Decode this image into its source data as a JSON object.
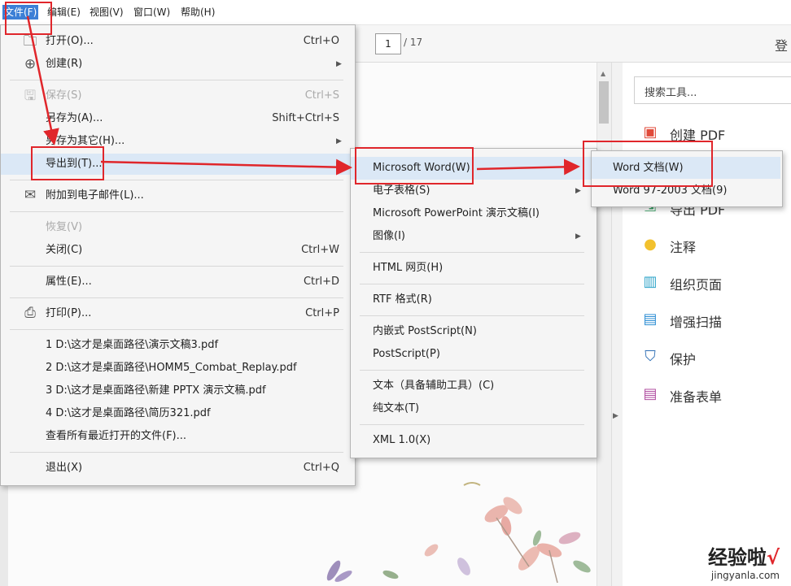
{
  "menubar": [
    "文件(F)",
    "编辑(E)",
    "视图(V)",
    "窗口(W)",
    "帮助(H)"
  ],
  "page": {
    "current": "1",
    "total": "/ 17"
  },
  "login": "登",
  "search_placeholder": "搜索工具...",
  "tools": [
    "创建 PDF",
    "导出 PDF",
    "注释",
    "组织页面",
    "增强扫描",
    "保护",
    "准备表单"
  ],
  "file_menu": [
    {
      "label": "打开(O)...",
      "shortcut": "Ctrl+O"
    },
    {
      "label": "创建(R)"
    },
    {
      "label": "保存(S)",
      "shortcut": "Ctrl+S"
    },
    {
      "label": "另存为(A)...",
      "shortcut": "Shift+Ctrl+S"
    },
    {
      "label": "另存为其它(H)..."
    },
    {
      "label": "导出到(T)..."
    },
    {
      "label": "附加到电子邮件(L)..."
    },
    {
      "label": "恢复(V)"
    },
    {
      "label": "关闭(C)",
      "shortcut": "Ctrl+W"
    },
    {
      "label": "属性(E)...",
      "shortcut": "Ctrl+D"
    },
    {
      "label": "打印(P)...",
      "shortcut": "Ctrl+P"
    },
    {
      "label": "1 D:\\这才是桌面路径\\演示文稿3.pdf"
    },
    {
      "label": "2 D:\\这才是桌面路径\\HOMM5_Combat_Replay.pdf"
    },
    {
      "label": "3 D:\\这才是桌面路径\\新建 PPTX 演示文稿.pdf"
    },
    {
      "label": "4 D:\\这才是桌面路径\\简历321.pdf"
    },
    {
      "label": "查看所有最近打开的文件(F)..."
    },
    {
      "label": "退出(X)",
      "shortcut": "Ctrl+Q"
    }
  ],
  "export_menu": [
    "Microsoft Word(W)",
    "电子表格(S)",
    "Microsoft PowerPoint 演示文稿(I)",
    "图像(I)",
    "HTML 网页(H)",
    "RTF 格式(R)",
    "内嵌式 PostScript(N)",
    "PostScript(P)",
    "文本（具备辅助工具）(C)",
    "纯文本(T)",
    "XML 1.0(X)"
  ],
  "word_menu": [
    "Word 文档(W)",
    "Word 97-2003 文档(9)"
  ],
  "watermark": {
    "main": "经验啦",
    "check": "√",
    "url": "jingyanla.com"
  },
  "colors": {
    "highlight": "#dbe8f6",
    "annotation_red": "#e0262b",
    "menubar_active": "#3c7fd6"
  }
}
